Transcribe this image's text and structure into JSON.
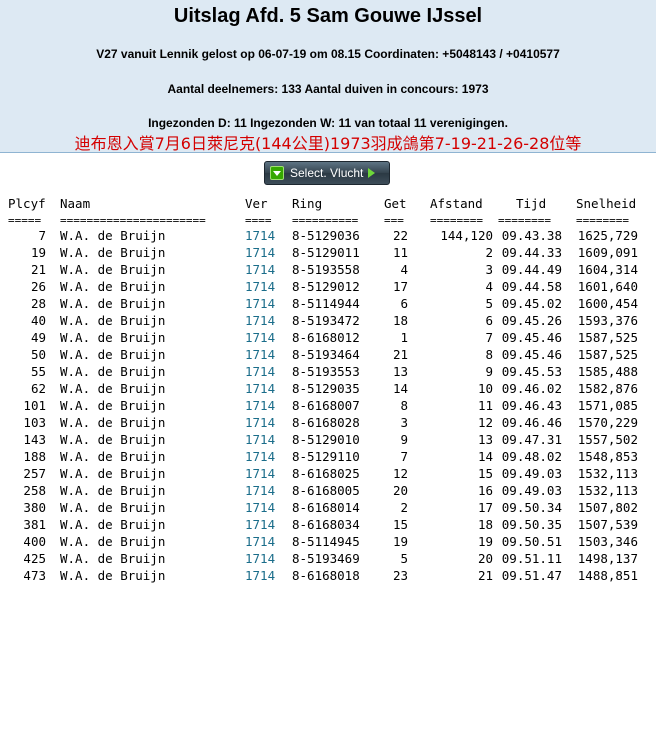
{
  "header": {
    "title": "Uitslag Afd. 5 Sam Gouwe IJssel",
    "line1": "V27 vanuit Lennik gelost op 06-07-19 om 08.15 Coordinaten: +5048143 / +0410577",
    "line2": "Aantal deelnemers: 133 Aantal duiven in concours: 1973",
    "line3": "Ingezonden D: 11 Ingezonden W: 11 van totaal 11 verenigingen.",
    "chinese_line": "迪布恩入賞7月6日萊尼克(144公里)1973羽成鴿第7-19-21-26-28位等"
  },
  "button": {
    "label": "Select. Vlucht",
    "icon_left": "down-arrow-icon",
    "icon_right": "right-arrow-icon"
  },
  "table": {
    "columns": {
      "plcyf": "Plcyf",
      "naam": "Naam",
      "ver": "Ver",
      "ring": "Ring",
      "get": "Get",
      "afstand": "Afstand",
      "tijd": "Tijd",
      "snelheid": "Snelheid"
    },
    "separators": {
      "plcyf": "=====",
      "naam": "======================",
      "ver": "====",
      "ring": "==========",
      "get": "===",
      "afstand": "========",
      "tijd": "========",
      "snelheid": "========"
    },
    "rows": [
      {
        "plcyf": "7",
        "naam": "W.A. de Bruijn",
        "ver": "1714",
        "ring": "8-5129036",
        "get": "22",
        "afstand": "144,120",
        "tijd": "09.43.38",
        "snelheid": "1625,729"
      },
      {
        "plcyf": "19",
        "naam": "W.A. de Bruijn",
        "ver": "1714",
        "ring": "8-5129011",
        "get": "11",
        "afstand": "2",
        "tijd": "09.44.33",
        "snelheid": "1609,091"
      },
      {
        "plcyf": "21",
        "naam": "W.A. de Bruijn",
        "ver": "1714",
        "ring": "8-5193558",
        "get": "4",
        "afstand": "3",
        "tijd": "09.44.49",
        "snelheid": "1604,314"
      },
      {
        "plcyf": "26",
        "naam": "W.A. de Bruijn",
        "ver": "1714",
        "ring": "8-5129012",
        "get": "17",
        "afstand": "4",
        "tijd": "09.44.58",
        "snelheid": "1601,640"
      },
      {
        "plcyf": "28",
        "naam": "W.A. de Bruijn",
        "ver": "1714",
        "ring": "8-5114944",
        "get": "6",
        "afstand": "5",
        "tijd": "09.45.02",
        "snelheid": "1600,454"
      },
      {
        "plcyf": "40",
        "naam": "W.A. de Bruijn",
        "ver": "1714",
        "ring": "8-5193472",
        "get": "18",
        "afstand": "6",
        "tijd": "09.45.26",
        "snelheid": "1593,376"
      },
      {
        "plcyf": "49",
        "naam": "W.A. de Bruijn",
        "ver": "1714",
        "ring": "8-6168012",
        "get": "1",
        "afstand": "7",
        "tijd": "09.45.46",
        "snelheid": "1587,525"
      },
      {
        "plcyf": "50",
        "naam": "W.A. de Bruijn",
        "ver": "1714",
        "ring": "8-5193464",
        "get": "21",
        "afstand": "8",
        "tijd": "09.45.46",
        "snelheid": "1587,525"
      },
      {
        "plcyf": "55",
        "naam": "W.A. de Bruijn",
        "ver": "1714",
        "ring": "8-5193553",
        "get": "13",
        "afstand": "9",
        "tijd": "09.45.53",
        "snelheid": "1585,488"
      },
      {
        "plcyf": "62",
        "naam": "W.A. de Bruijn",
        "ver": "1714",
        "ring": "8-5129035",
        "get": "14",
        "afstand": "10",
        "tijd": "09.46.02",
        "snelheid": "1582,876"
      },
      {
        "plcyf": "101",
        "naam": "W.A. de Bruijn",
        "ver": "1714",
        "ring": "8-6168007",
        "get": "8",
        "afstand": "11",
        "tijd": "09.46.43",
        "snelheid": "1571,085"
      },
      {
        "plcyf": "103",
        "naam": "W.A. de Bruijn",
        "ver": "1714",
        "ring": "8-6168028",
        "get": "3",
        "afstand": "12",
        "tijd": "09.46.46",
        "snelheid": "1570,229"
      },
      {
        "plcyf": "143",
        "naam": "W.A. de Bruijn",
        "ver": "1714",
        "ring": "8-5129010",
        "get": "9",
        "afstand": "13",
        "tijd": "09.47.31",
        "snelheid": "1557,502"
      },
      {
        "plcyf": "188",
        "naam": "W.A. de Bruijn",
        "ver": "1714",
        "ring": "8-5129110",
        "get": "7",
        "afstand": "14",
        "tijd": "09.48.02",
        "snelheid": "1548,853"
      },
      {
        "plcyf": "257",
        "naam": "W.A. de Bruijn",
        "ver": "1714",
        "ring": "8-6168025",
        "get": "12",
        "afstand": "15",
        "tijd": "09.49.03",
        "snelheid": "1532,113"
      },
      {
        "plcyf": "258",
        "naam": "W.A. de Bruijn",
        "ver": "1714",
        "ring": "8-6168005",
        "get": "20",
        "afstand": "16",
        "tijd": "09.49.03",
        "snelheid": "1532,113"
      },
      {
        "plcyf": "380",
        "naam": "W.A. de Bruijn",
        "ver": "1714",
        "ring": "8-6168014",
        "get": "2",
        "afstand": "17",
        "tijd": "09.50.34",
        "snelheid": "1507,802"
      },
      {
        "plcyf": "381",
        "naam": "W.A. de Bruijn",
        "ver": "1714",
        "ring": "8-6168034",
        "get": "15",
        "afstand": "18",
        "tijd": "09.50.35",
        "snelheid": "1507,539"
      },
      {
        "plcyf": "400",
        "naam": "W.A. de Bruijn",
        "ver": "1714",
        "ring": "8-5114945",
        "get": "19",
        "afstand": "19",
        "tijd": "09.50.51",
        "snelheid": "1503,346"
      },
      {
        "plcyf": "425",
        "naam": "W.A. de Bruijn",
        "ver": "1714",
        "ring": "8-5193469",
        "get": "5",
        "afstand": "20",
        "tijd": "09.51.11",
        "snelheid": "1498,137"
      },
      {
        "plcyf": "473",
        "naam": "W.A. de Bruijn",
        "ver": "1714",
        "ring": "8-6168018",
        "get": "23",
        "afstand": "21",
        "tijd": "09.51.47",
        "snelheid": "1488,851"
      }
    ]
  }
}
